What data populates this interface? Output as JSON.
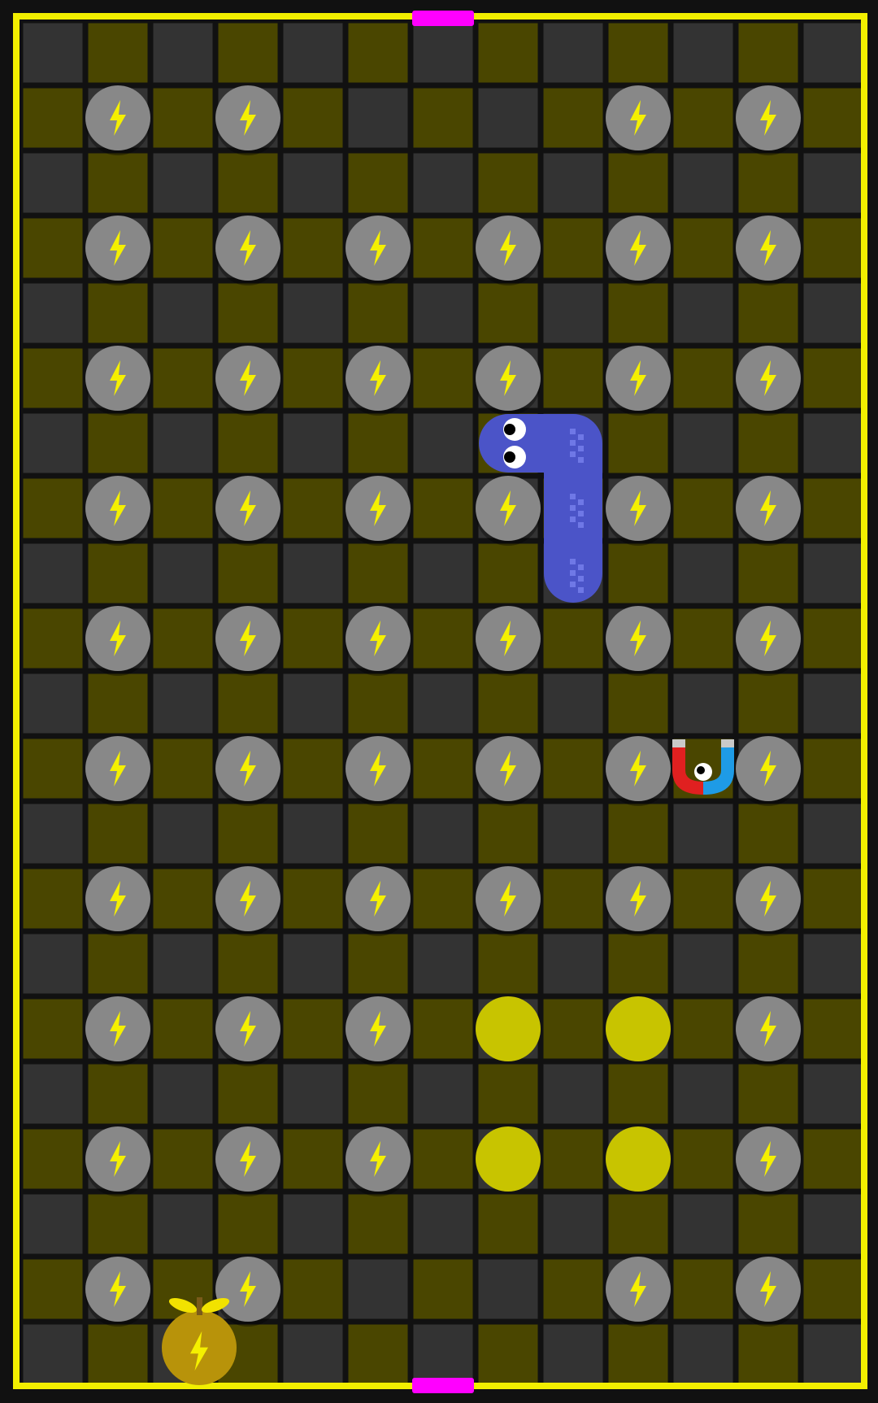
{
  "game": {
    "grid": {
      "cols": 13,
      "rows": 21
    },
    "colors": {
      "background": "#111111",
      "tile_dark": "#333333",
      "tile_olive": "#4a4600",
      "wall": "#f2ef00",
      "portal": "#ff00ff",
      "energy_orb": "#888888",
      "bolt": "#f5f000",
      "empty_slot": "#c8c400",
      "snake": "#4b54c8",
      "snake_pattern": "#6f78e6",
      "fruit": "#b8930a",
      "fruit_leaf": "#f2e200",
      "magnet_red": "#e02020",
      "magnet_blue": "#1e9be6",
      "magnet_tip": "#c9c9c9"
    },
    "portals": [
      {
        "side": "top",
        "col": 6
      },
      {
        "side": "bottom",
        "col": 6
      }
    ],
    "energy_orbs": [
      [
        1,
        1
      ],
      [
        3,
        1
      ],
      [
        9,
        1
      ],
      [
        11,
        1
      ],
      [
        1,
        3
      ],
      [
        3,
        3
      ],
      [
        5,
        3
      ],
      [
        7,
        3
      ],
      [
        9,
        3
      ],
      [
        11,
        3
      ],
      [
        1,
        5
      ],
      [
        3,
        5
      ],
      [
        5,
        5
      ],
      [
        7,
        5
      ],
      [
        9,
        5
      ],
      [
        11,
        5
      ],
      [
        1,
        7
      ],
      [
        3,
        7
      ],
      [
        5,
        7
      ],
      [
        7,
        7
      ],
      [
        9,
        7
      ],
      [
        11,
        7
      ],
      [
        1,
        9
      ],
      [
        3,
        9
      ],
      [
        5,
        9
      ],
      [
        7,
        9
      ],
      [
        9,
        9
      ],
      [
        11,
        9
      ],
      [
        1,
        11
      ],
      [
        3,
        11
      ],
      [
        5,
        11
      ],
      [
        7,
        11
      ],
      [
        9,
        11
      ],
      [
        11,
        11
      ],
      [
        1,
        13
      ],
      [
        3,
        13
      ],
      [
        5,
        13
      ],
      [
        7,
        13
      ],
      [
        9,
        13
      ],
      [
        11,
        13
      ],
      [
        1,
        15
      ],
      [
        3,
        15
      ],
      [
        5,
        15
      ],
      [
        11,
        15
      ],
      [
        1,
        17
      ],
      [
        3,
        17
      ],
      [
        5,
        17
      ],
      [
        11,
        17
      ],
      [
        1,
        19
      ],
      [
        3,
        19
      ],
      [
        9,
        19
      ],
      [
        11,
        19
      ]
    ],
    "empty_slots": [
      [
        7,
        15
      ],
      [
        9,
        15
      ],
      [
        7,
        17
      ],
      [
        9,
        17
      ]
    ],
    "snake": {
      "head": [
        7,
        6
      ],
      "body": [
        [
          8,
          6
        ],
        [
          8,
          7
        ],
        [
          8,
          8
        ]
      ],
      "direction": "left"
    },
    "magnet": {
      "cell": [
        10,
        11
      ]
    },
    "fruit": {
      "cell": [
        2,
        20
      ],
      "icon": "bolt-fruit-icon"
    }
  }
}
